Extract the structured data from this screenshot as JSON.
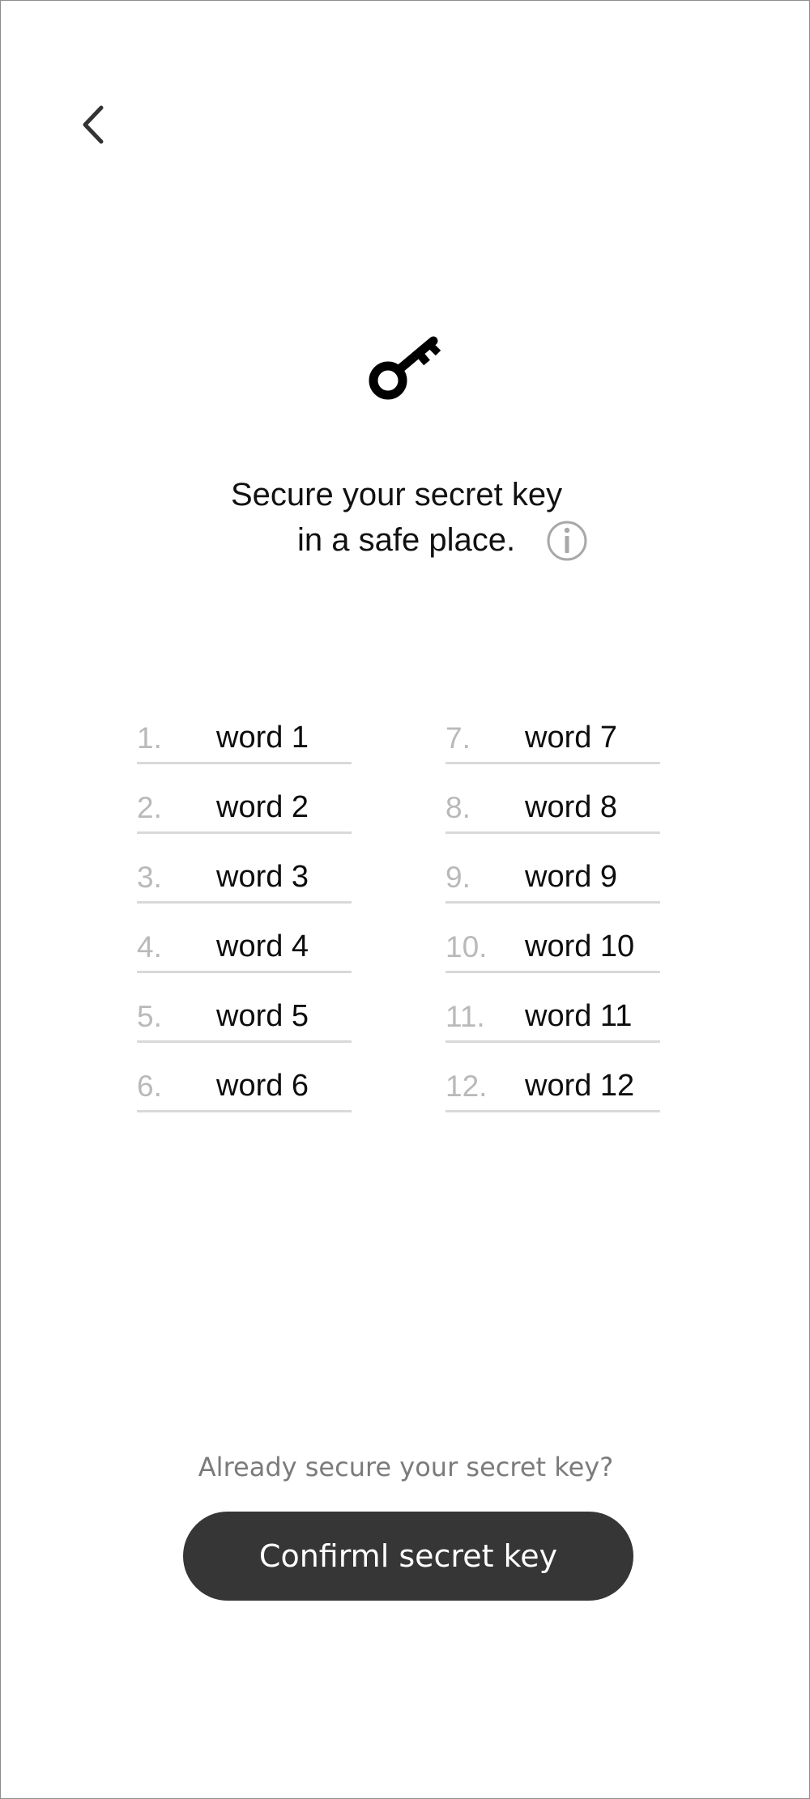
{
  "navigation": {
    "back_icon": "chevron-left-icon"
  },
  "hero": {
    "icon": "key-icon",
    "title_line1": "Secure your secret key",
    "title_line2": "in a safe place.",
    "info_icon": "info-icon"
  },
  "secret_words": [
    {
      "number": "1.",
      "word": "word 1"
    },
    {
      "number": "2.",
      "word": "word 2"
    },
    {
      "number": "3.",
      "word": "word 3"
    },
    {
      "number": "4.",
      "word": "word 4"
    },
    {
      "number": "5.",
      "word": "word 5"
    },
    {
      "number": "6.",
      "word": "word 6"
    },
    {
      "number": "7.",
      "word": "word 7"
    },
    {
      "number": "8.",
      "word": "word 8"
    },
    {
      "number": "9.",
      "word": "word 9"
    },
    {
      "number": "10.",
      "word": "word 10"
    },
    {
      "number": "11.",
      "word": "word 11"
    },
    {
      "number": "12.",
      "word": "word 12"
    }
  ],
  "footer": {
    "hint": "Already secure your secret key?",
    "confirm_label": "Confirml secret key"
  },
  "colors": {
    "button_bg": "#363636",
    "word_number": "#b9b9b9",
    "divider": "#d9d9d9",
    "hint_text": "#7b7b7b"
  }
}
